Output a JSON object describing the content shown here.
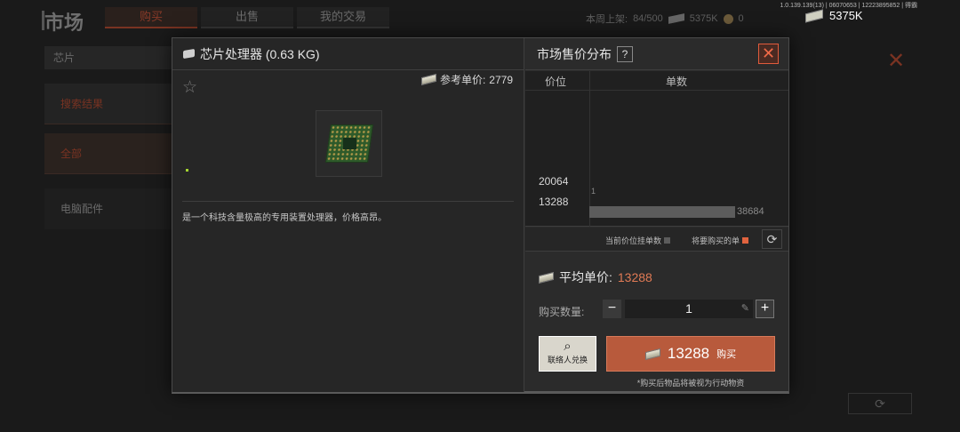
{
  "background": {
    "title": "市场",
    "tabs": [
      "购买",
      "出售",
      "我的交易"
    ],
    "weekly_listing_label": "本周上架:",
    "weekly_listing_value": "84/500",
    "funds_value": "5375K",
    "coin_value": "0",
    "server_info": "1.0.139.139(13) | 06070653 | 12223895852 | 得霸",
    "top_money": "5375K",
    "side": {
      "chip": "芯片",
      "search_results": "搜索结果",
      "all": "全部",
      "pc_parts": "电脑配件"
    }
  },
  "item": {
    "name": "芯片处理器 (0.63 KG)",
    "ref_price_label": "参考单价:",
    "ref_price_value": "2779",
    "description": "是一个科技含量极高的专用装置处理器，价格高昂。"
  },
  "market": {
    "title": "市场售价分布",
    "help": "?",
    "col_price": "价位",
    "col_qty": "单数",
    "price_high": "20064",
    "price_low": "13288",
    "bar_count": "1",
    "bar_fill": 0.75,
    "bar_qty": "38684",
    "legend_current": "当前价位挂单数",
    "legend_buy": "将要购买的单",
    "legend_current_color": "#5c5c5c",
    "legend_buy_color": "#e0633f"
  },
  "purchase": {
    "avg_label": "平均单价:",
    "avg_value": "13288",
    "qty_label": "购买数量:",
    "qty_value": "1",
    "exchange_label": "联络人兑换",
    "buy_amount": "13288",
    "buy_label": "购买",
    "note": "*购买后物品将被视为行动物资"
  }
}
